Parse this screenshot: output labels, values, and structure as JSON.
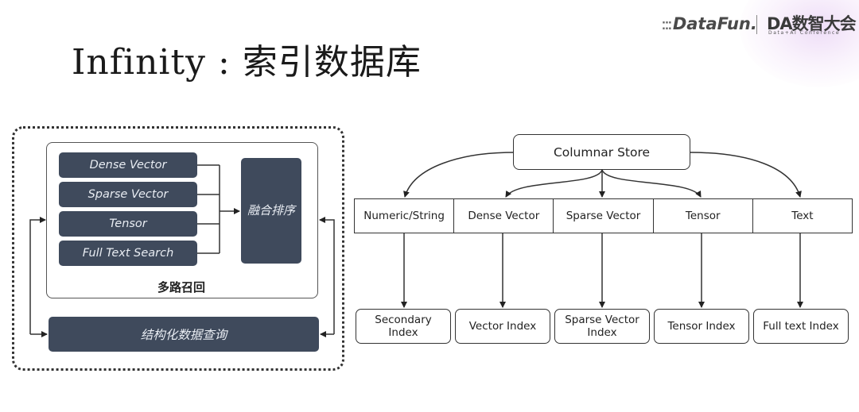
{
  "title": "Infinity : 索引数据库",
  "logos": {
    "datafun_dots": "⁚⁚⁚",
    "datafun": "DataFun.",
    "conference_mark": "DA数智大会",
    "conference_sub": "Data+AI Conference"
  },
  "left_diagram": {
    "recall_methods": [
      "Dense Vector",
      "Sparse Vector",
      "Tensor",
      "Full Text Search"
    ],
    "fusion_box": [
      "融合",
      "排序"
    ],
    "recall_group_label": "多路召回",
    "structured_query": "结构化数据查询"
  },
  "right_diagram": {
    "root": "Columnar Store",
    "column_types": [
      "Numeric/String",
      "Dense Vector",
      "Sparse Vector",
      "Tensor",
      "Text"
    ],
    "indexes": [
      "Secondary\nIndex",
      "Vector Index",
      "Sparse Vector\nIndex",
      "Tensor Index",
      "Full text Index"
    ]
  }
}
